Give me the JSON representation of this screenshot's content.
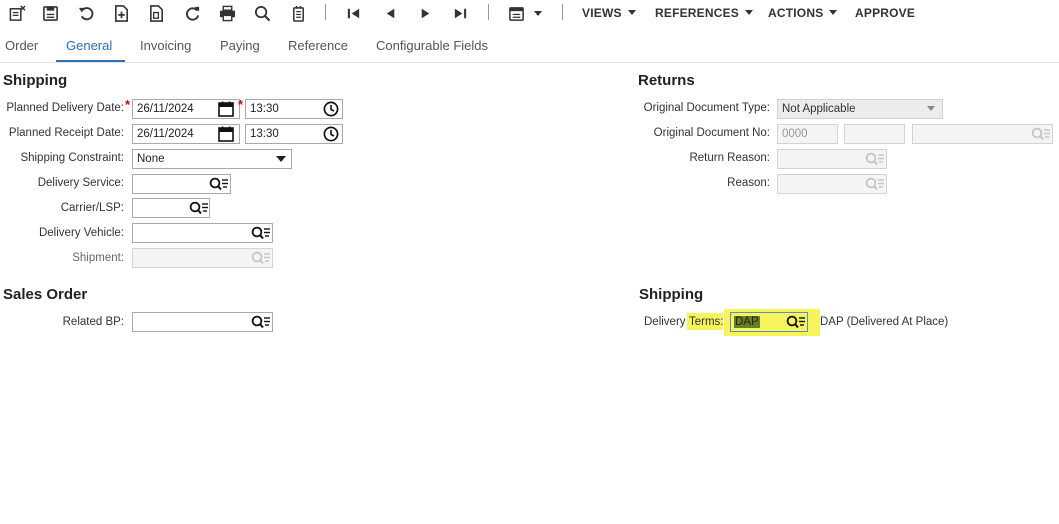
{
  "toolbar": {
    "menus": {
      "views": "VIEWS",
      "references": "REFERENCES",
      "actions": "ACTIONS",
      "approve": "APPROVE"
    }
  },
  "tabs": [
    "Order",
    "General",
    "Invoicing",
    "Paying",
    "Reference",
    "Configurable Fields"
  ],
  "active_tab": "General",
  "shipping": {
    "title": "Shipping",
    "planned_delivery_date_label": "Planned Delivery Date:",
    "planned_delivery_date": "26/11/2024",
    "planned_delivery_time": "13:30",
    "planned_receipt_date_label": "Planned Receipt Date:",
    "planned_receipt_date": "26/11/2024",
    "planned_receipt_time": "13:30",
    "shipping_constraint_label": "Shipping Constraint:",
    "shipping_constraint": "None",
    "delivery_service_label": "Delivery Service:",
    "delivery_service": "",
    "carrier_label": "Carrier/LSP:",
    "carrier": "",
    "delivery_vehicle_label": "Delivery Vehicle:",
    "delivery_vehicle": "",
    "shipment_label": "Shipment:",
    "shipment": ""
  },
  "sales_order": {
    "title": "Sales Order",
    "related_bp_label": "Related BP:",
    "related_bp": ""
  },
  "returns": {
    "title": "Returns",
    "original_document_type_label": "Original Document Type:",
    "original_document_type": "Not Applicable",
    "original_document_no_label": "Original Document No:",
    "original_document_no": "0000",
    "return_reason_label": "Return Reason:",
    "return_reason": "",
    "reason_label": "Reason:",
    "reason": ""
  },
  "shipping_terms": {
    "title": "Shipping",
    "delivery_label": "Delivery",
    "terms_label": "Terms:",
    "delivery_terms": "DAP",
    "delivery_terms_description": "DAP (Delivered At Place)"
  },
  "colors": {
    "accent": "#2a6fb8",
    "required": "#dd0000",
    "highlight": "#f6f45a"
  }
}
